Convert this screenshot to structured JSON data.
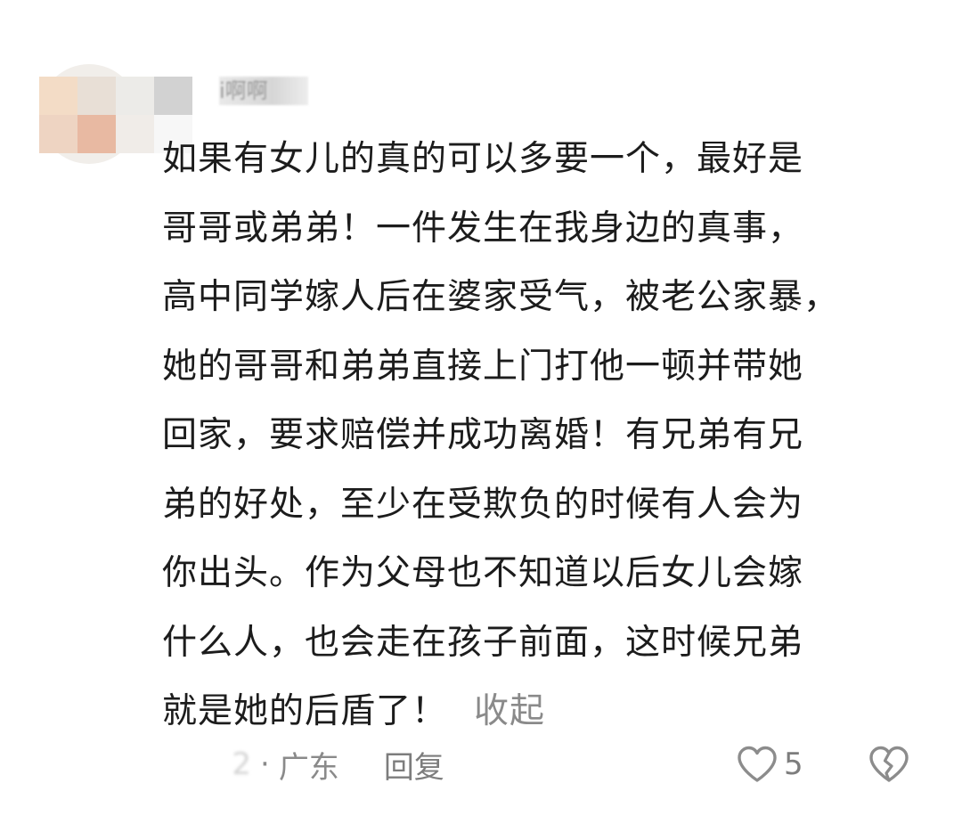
{
  "comment": {
    "username": "i啊啊",
    "lines": [
      "如果有女儿的真的可以多要一个，最好是",
      "哥哥或弟弟！一件发生在我身边的真事，",
      "高中同学嫁人后在婆家受气，被老公家暴，",
      "她的哥哥和弟弟直接上门打他一顿并带她",
      "回家，要求赔偿并成功离婚！有兄弟有兄",
      "弟的好处，至少在受欺负的时候有人会为",
      "你出头。作为父母也不知道以后女儿会嫁",
      "什么人，也会走在孩子前面，这时候兄弟",
      "就是她的后盾了！"
    ],
    "collapse_label": "收起",
    "time": "2",
    "separator": "·",
    "location": "广东",
    "reply_label": "回复",
    "like_count": "5",
    "icons": {
      "like": "heart-outline-icon",
      "dislike": "broken-heart-icon"
    },
    "colors": {
      "text": "#1c1c1c",
      "meta": "#8a8a8a",
      "icon": "#8c8c8c"
    }
  }
}
